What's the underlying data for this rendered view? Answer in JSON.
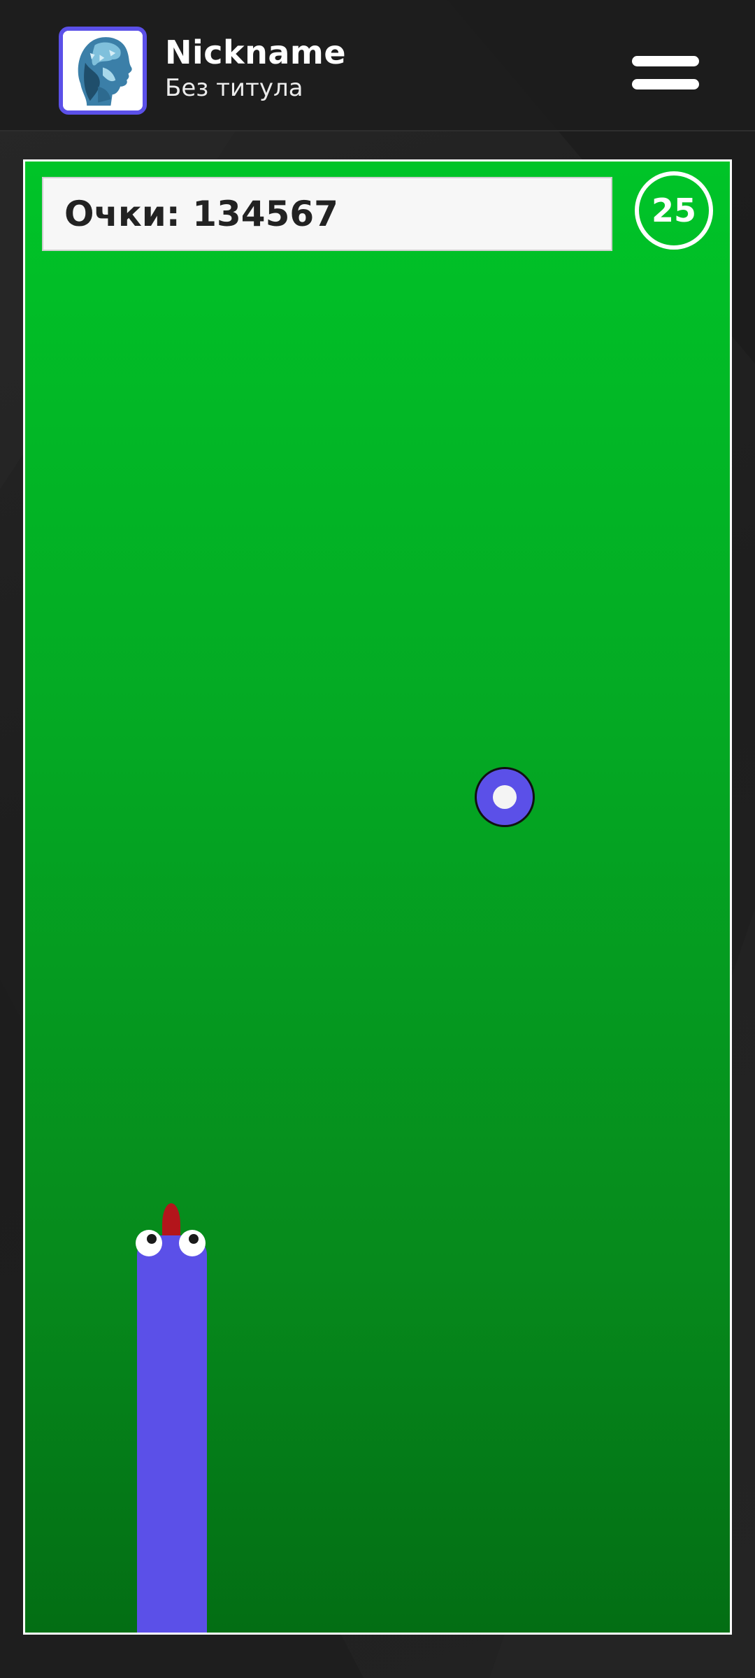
{
  "header": {
    "nickname": "Nickname",
    "title": "Без титула",
    "avatar_icon": "face-portrait-icon",
    "menu_icon": "hamburger-menu-icon"
  },
  "game": {
    "score_label": "Очки: 134567",
    "timer": "25",
    "food_icon": "food-orb-icon",
    "snake_direction": "up"
  },
  "colors": {
    "accent": "#5b50e8",
    "field_top": "#00c428",
    "field_bottom": "#036e14",
    "tongue": "#b3151b",
    "background": "#202020"
  }
}
